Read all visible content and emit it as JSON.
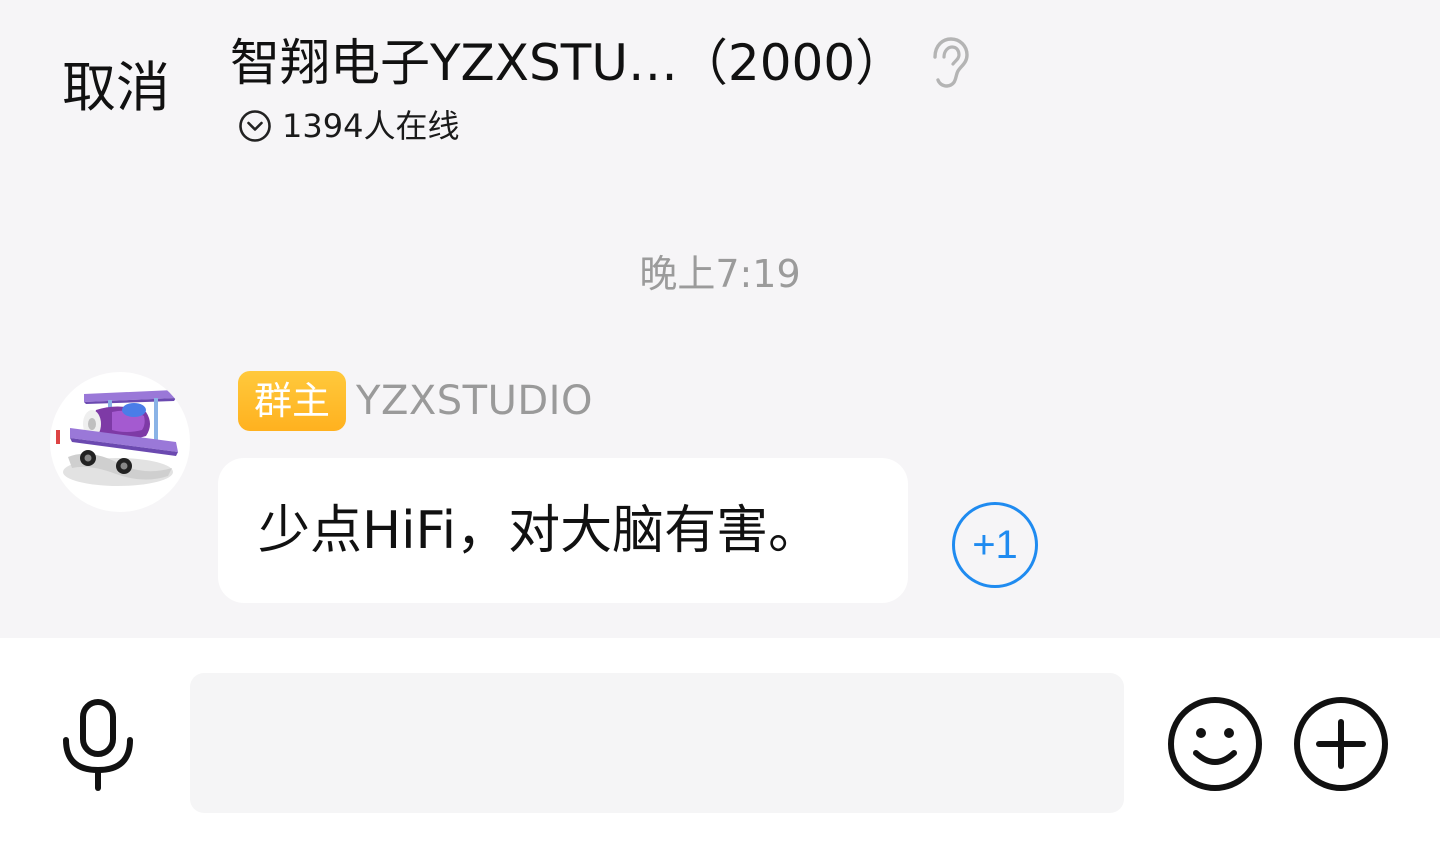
{
  "header": {
    "cancel_label": "取消",
    "title": "智翔电子YZXSTU…（2000）",
    "ear_icon": "ear-icon",
    "online_icon": "chevron-down-circle-icon",
    "online_text": "1394人在线"
  },
  "chat": {
    "timestamp": "晚上7:19",
    "message": {
      "avatar_icon": "biplane-avatar",
      "badge": "群主",
      "sender": "YZXSTUDIO",
      "text": "少点HiFi，对大脑有害。",
      "plus_one_label": "+1"
    }
  },
  "input_bar": {
    "voice_icon": "microphone-icon",
    "message_value": "",
    "emoji_icon": "smiley-icon",
    "more_icon": "plus-circle-icon"
  },
  "colors": {
    "background": "#f6f5f7",
    "badge": "#ffb11f",
    "plus_one": "#1f8bf0",
    "muted_text": "#9b9b9b"
  }
}
